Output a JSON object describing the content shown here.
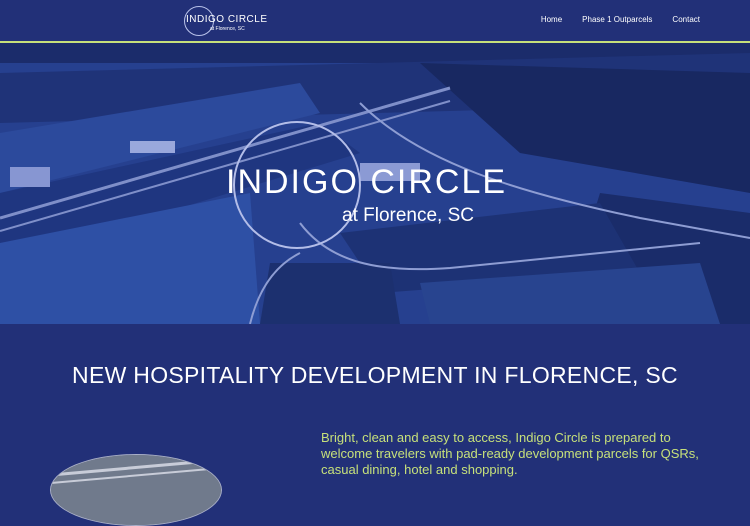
{
  "header": {
    "logo": {
      "title": "INDIGO CIRCLE",
      "subtitle": "at Florence, SC"
    },
    "nav": [
      {
        "label": "Home"
      },
      {
        "label": "Phase 1 Outparcels"
      },
      {
        "label": "Contact"
      }
    ]
  },
  "hero": {
    "title": "INDIGO CIRCLE",
    "subtitle": "at Florence, SC"
  },
  "main": {
    "heading": "NEW HOSPITALITY DEVELOPMENT IN FLORENCE, SC",
    "intro": "Bright, clean and easy to access, Indigo Circle is prepared to welcome travelers with pad-ready development parcels for QSRs, casual dining, hotel and shopping."
  },
  "colors": {
    "background": "#223078",
    "accent": "#c6e07a",
    "text": "#ffffff"
  }
}
